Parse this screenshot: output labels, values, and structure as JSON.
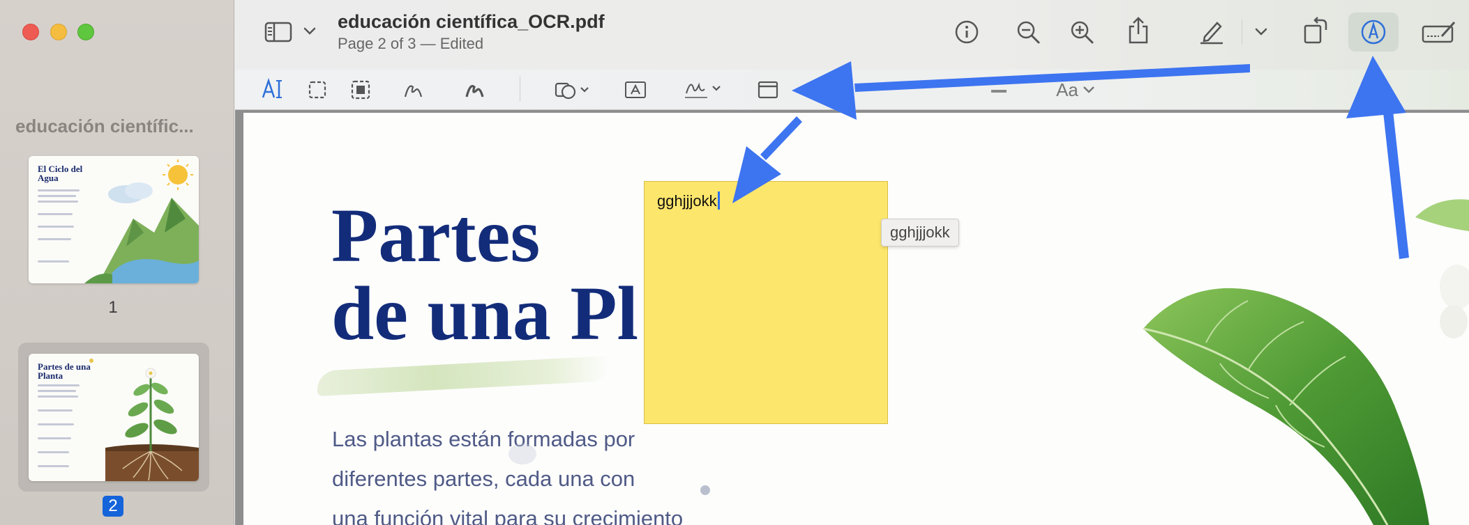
{
  "window": {
    "title": "educación científica_OCR.pdf",
    "subtitle": "Page 2 of 3 — Edited"
  },
  "sidebar": {
    "document_name": "educación científic...",
    "thumbnails": [
      {
        "page_label": "1",
        "thumb_title": "El Ciclo del Agua",
        "selected": false
      },
      {
        "page_label": "2",
        "thumb_title": "Partes de una Planta",
        "selected": true
      }
    ]
  },
  "toolbar": {
    "icons": [
      "sidebar-toggle-icon",
      "chevron-down-icon",
      "info-icon",
      "zoom-out-icon",
      "zoom-in-icon",
      "share-icon",
      "highlight-pen-icon",
      "chevron-down-icon",
      "rotate-icon",
      "markup-icon",
      "form-fill-icon"
    ]
  },
  "markup_toolbar": {
    "icons": [
      "text-selection-icon",
      "rect-selection-icon",
      "smart-lasso-icon",
      "sketch-icon",
      "draw-icon",
      "shapes-icon",
      "text-box-icon",
      "sign-icon",
      "note-icon",
      "border-color-icon",
      "text-style-icon"
    ],
    "text_style_label": "Aa"
  },
  "page": {
    "heading_line1": "Partes",
    "heading_line2": "de una Pl",
    "body_line1": "Las plantas están formadas por",
    "body_line2": "diferentes partes, cada una con",
    "body_line3": "una función vital para su crecimiento"
  },
  "note": {
    "text": "gghjjjokk",
    "tooltip": "gghjjjokk"
  },
  "colors": {
    "heading": "#132c7a",
    "sticky_note": "#fde66c",
    "annotation_arrow": "#3d74f0",
    "selection_blue": "#1564d9"
  }
}
